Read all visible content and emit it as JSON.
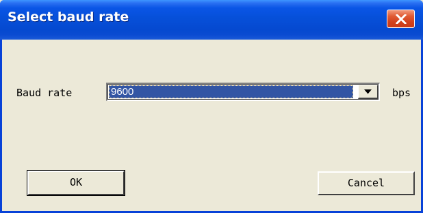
{
  "window": {
    "title": "Select baud rate",
    "colors": {
      "titlebar": "#0650d9",
      "close": "#d1401b",
      "face": "#ece9d8",
      "selection": "#3255a4"
    }
  },
  "form": {
    "baud_label": "Baud rate",
    "baud_value": "9600",
    "unit": "bps"
  },
  "buttons": {
    "ok": "OK",
    "cancel": "Cancel"
  },
  "icons": {
    "close": "close-icon",
    "dropdown": "chevron-down-icon"
  }
}
